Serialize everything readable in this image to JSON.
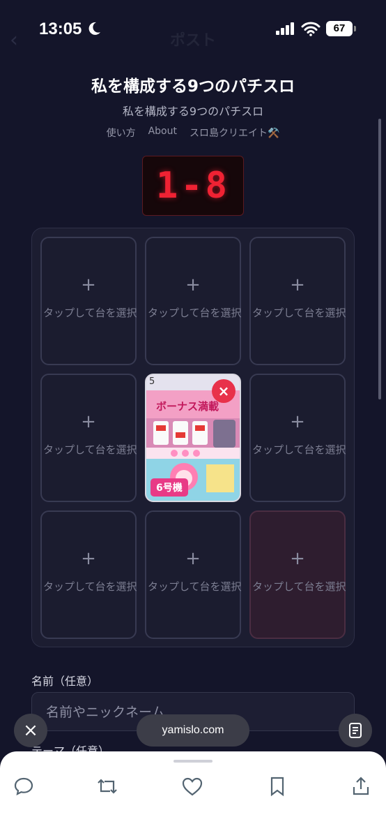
{
  "status": {
    "time": "13:05",
    "battery": "67"
  },
  "nav": {
    "back": "‹",
    "title": "ポスト"
  },
  "header": {
    "title": "私を構成する9つのパチスロ",
    "subtitle": "私を構成する9つのパチスロ",
    "links": [
      "使い方",
      "About",
      "スロ島クリエイト⚒️"
    ]
  },
  "counter": "1-8",
  "grid": {
    "plus": "+",
    "empty_label": "タップして台を選択",
    "filled": {
      "corner_number": "5",
      "remove": "×",
      "badge": "6号機",
      "title_art": "ボーナス満載"
    }
  },
  "form": {
    "name_label": "名前（任意）",
    "name_placeholder": "名前やニックネーム",
    "theme_label": "テーマ（任意）"
  },
  "browser": {
    "domain": "yamislo.com",
    "close": "×"
  },
  "colors": {
    "background": "#14152a",
    "counter_red": "#ef2233",
    "badge_pink": "#e83a86",
    "remove_red": "#e8314a"
  },
  "icons": [
    "moon-icon",
    "signal-icon",
    "wifi-icon",
    "reply-icon",
    "repost-icon",
    "like-icon",
    "bookmark-icon",
    "share-icon",
    "reader-icon"
  ]
}
